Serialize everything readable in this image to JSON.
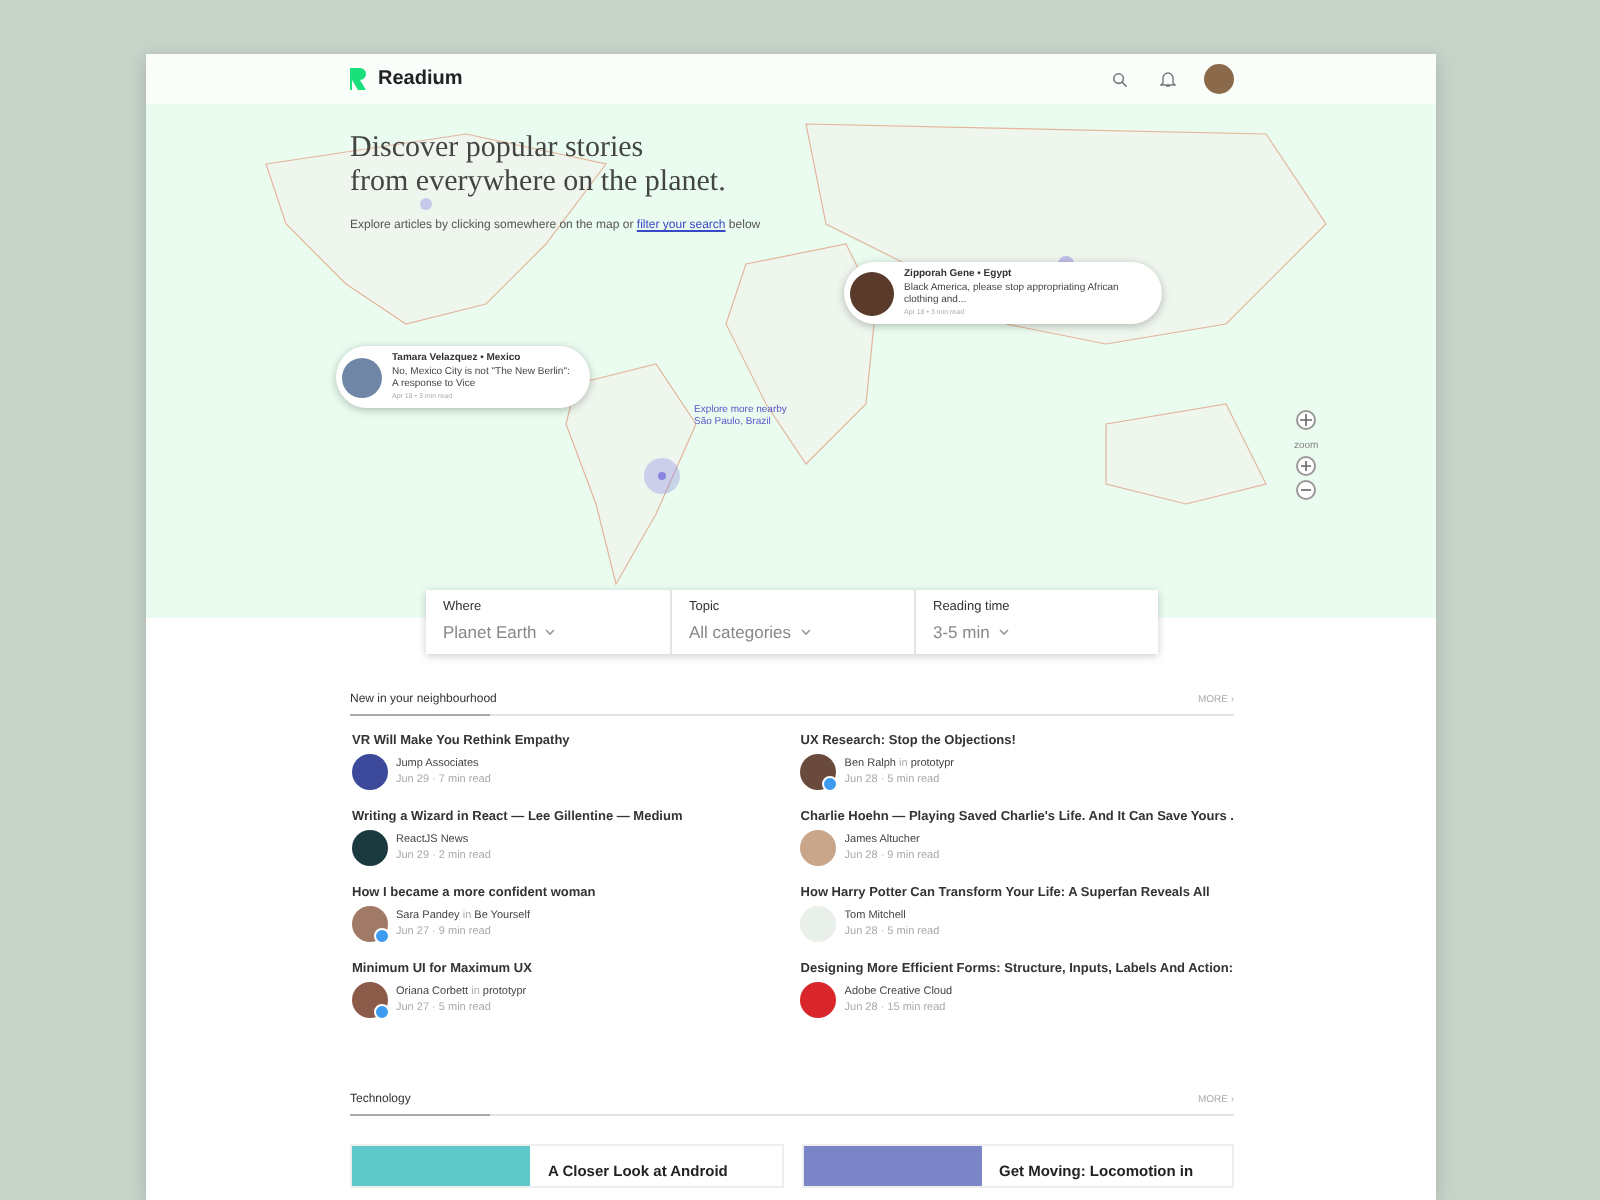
{
  "header": {
    "brand": "Readium"
  },
  "hero": {
    "title_lines": [
      "Discover popular stories",
      "from everywhere on the planet."
    ],
    "subtitle_before": "Explore articles by clicking somewhere on the map or ",
    "subtitle_link": "filter your search",
    "subtitle_after": " below"
  },
  "map_pins": [
    {
      "author": "Zipporah Gene • Egypt",
      "headline": "Black America, please stop appropriating African clothing and...",
      "meta": "Apr 18 • 3 min read"
    },
    {
      "author": "Tamara Velazquez • Mexico",
      "headline": "No, Mexico City is not \"The New Berlin\": A response to Vice",
      "meta": "Apr 18 • 3 min read"
    }
  ],
  "nearby": {
    "line1": "Explore more nearby",
    "line2": "São Paulo, Brazil"
  },
  "zoom_label": "zoom",
  "filters": [
    {
      "label": "Where",
      "value": "Planet Earth"
    },
    {
      "label": "Topic",
      "value": "All categories"
    },
    {
      "label": "Reading time",
      "value": "3-5 min"
    }
  ],
  "neighbourhood": {
    "title": "New in your neighbourhood",
    "more": "MORE ›",
    "articles": [
      {
        "title": "VR Will Make You Rethink Empathy",
        "author": "Jump Associates",
        "meta": "Jun 29 · 7 min read",
        "badge": false
      },
      {
        "title": "UX Research: Stop the Objections!",
        "author": "Ben Ralph",
        "joiner": "in",
        "publication": "prototypr",
        "meta": "Jun 28 · 5 min read",
        "badge": true
      },
      {
        "title": "Writing a Wizard in React — Lee Gillentine — Medium",
        "author": "ReactJS News",
        "meta": "Jun 29 · 2 min read",
        "badge": false
      },
      {
        "title": "Charlie Hoehn — Playing Saved Charlie's Life. And It Can Save Yours .",
        "author": "James Altucher",
        "meta": "Jun 28 · 9 min read",
        "badge": false
      },
      {
        "title": "How I became a more confident woman",
        "author": "Sara Pandey",
        "joiner": "in",
        "publication": "Be Yourself",
        "meta": "Jun 27 · 9 min read",
        "badge": true
      },
      {
        "title": "How Harry Potter Can Transform Your Life: A Superfan Reveals All",
        "author": "Tom Mitchell",
        "meta": "Jun 28 · 5 min read",
        "badge": false
      },
      {
        "title": "Minimum UI for Maximum UX",
        "author": "Oriana Corbett",
        "joiner": "in",
        "publication": "prototypr",
        "meta": "Jun 27 · 5 min read",
        "badge": true
      },
      {
        "title": "Designing More Efficient Forms: Structure, Inputs, Labels And Action:",
        "author": "Adobe Creative Cloud",
        "meta": "Jun 28 · 15 min read",
        "badge": false
      }
    ]
  },
  "technology": {
    "title": "Technology",
    "more": "MORE ›",
    "cards": [
      {
        "title": "A Closer Look at Android"
      },
      {
        "title": "Get Moving: Locomotion in"
      }
    ]
  }
}
